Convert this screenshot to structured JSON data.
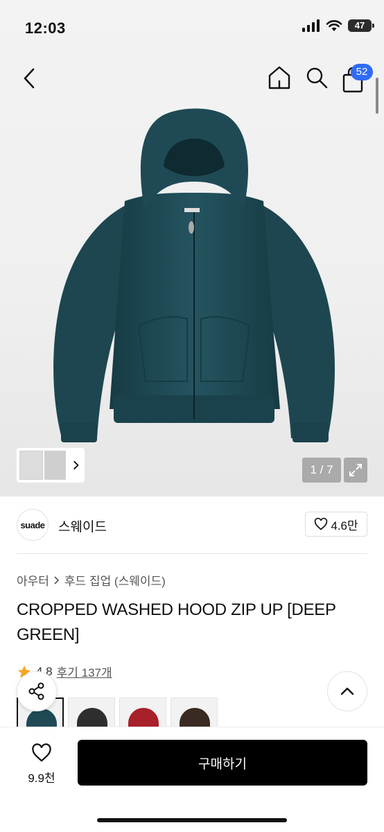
{
  "status_bar": {
    "time": "12:03",
    "battery": "47",
    "icons": [
      "signal-icon",
      "wifi-icon",
      "battery-icon"
    ]
  },
  "nav": {
    "icons": [
      "back-icon",
      "home-icon",
      "search-icon",
      "bag-icon"
    ],
    "cart_count": "52"
  },
  "gallery": {
    "pager": "1 / 7",
    "product_color": "#1f4a55"
  },
  "brand": {
    "logo_text": "suade",
    "name": "스웨이드",
    "likes": "4.6만"
  },
  "breadcrumb": {
    "level1": "아우터",
    "level2": "후드 집업 (스웨이드)"
  },
  "product": {
    "title": "CROPPED WASHED HOOD ZIP UP [DEEP GREEN]"
  },
  "rating": {
    "score": "4.8",
    "reviews": "후기 137개"
  },
  "variants": [
    {
      "color": "#1f4a55"
    },
    {
      "color": "#2e2e2e"
    },
    {
      "color": "#a8202a"
    },
    {
      "color": "#3a2a22"
    }
  ],
  "bottom_bar": {
    "wish_count": "9.9천",
    "buy_label": "구매하기"
  },
  "colors": {
    "accent": "#2f6bf5",
    "star": "#f5a623",
    "buy_button": "#000000"
  }
}
